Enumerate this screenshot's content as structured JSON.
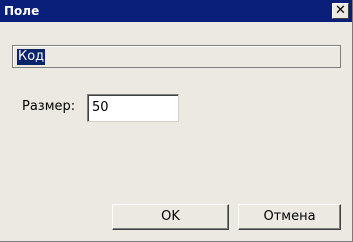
{
  "window": {
    "title": "Поле",
    "close_glyph": "✕",
    "titlebar_color": "#0a1f7a",
    "background_color": "#ece9e2"
  },
  "name_field": {
    "value": "Код",
    "selection_color": "#0a246a"
  },
  "size_field": {
    "label": "Размер:",
    "value": "50"
  },
  "buttons": {
    "ok_label": "OK",
    "cancel_label": "Отмена"
  },
  "icons": {
    "close": "close-icon"
  }
}
